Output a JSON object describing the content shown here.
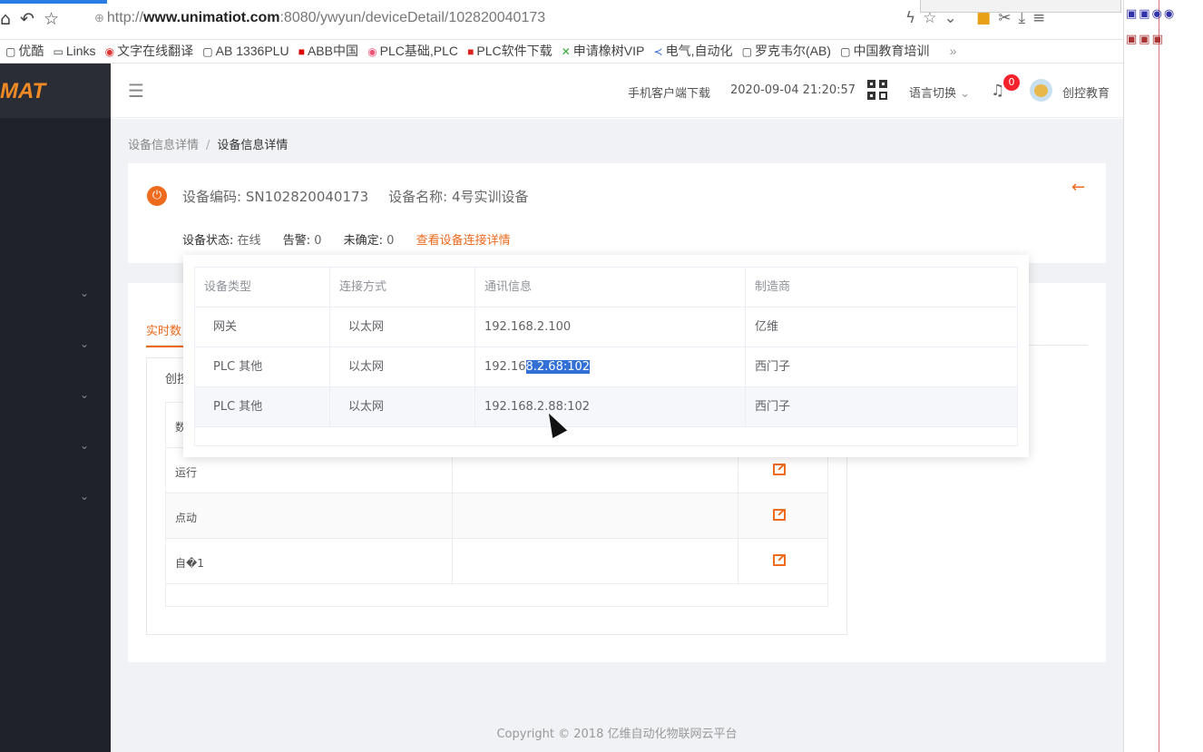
{
  "browser": {
    "url_domain": "www.unimatiot.com",
    "url_prefix": "http://",
    "url_suffix": ":8080/ywyun/deviceDetail/102820040173",
    "bookmarks": [
      "优酷",
      "Links",
      "文字在线翻译",
      "AB 1336PLU",
      "ABB中国",
      "PLC基础,PLC",
      "PLC软件下载",
      "申请橡树VIP",
      "电气,自动化",
      "罗克韦尔(AB)",
      "中国教育培训"
    ],
    "more": "»"
  },
  "sidebar": {
    "logo": "MAT"
  },
  "header": {
    "mobile_download": "手机客户端下载",
    "datetime": "2020-09-04 21:20:57",
    "language": "语言切换",
    "notification_count": "0",
    "user_name": "创控教育"
  },
  "breadcrumb": {
    "parent": "设备信息详情",
    "current": "设备信息详情"
  },
  "device": {
    "code_label": "设备编码:",
    "code_value": "SN102820040173",
    "name_label": "设备名称:",
    "name_value": "4号实训设备",
    "status_label": "设备状态:",
    "status_value": "在线",
    "alarm_label": "告警:",
    "alarm_value": "0",
    "unconfirmed_label": "未确定:",
    "unconfirmed_value": "0",
    "view_link": "查看设备连接详情"
  },
  "main": {
    "tab_label": "实时数",
    "inner_label": "创控",
    "rows": [
      {
        "name": "数"
      },
      {
        "name": "运行"
      },
      {
        "name": "点动"
      },
      {
        "name": "自�1"
      }
    ]
  },
  "popup": {
    "headers": [
      "设备类型",
      "连接方式",
      "通讯信息",
      "制造商"
    ],
    "rows": [
      {
        "type": "网关",
        "conn": "以太网",
        "comm_a": "192.168.2.100",
        "comm_b": "",
        "maker": "亿维"
      },
      {
        "type": "PLC   其他",
        "conn": "以太网",
        "comm_a": "192.16",
        "comm_b": "8.2.68:102",
        "maker": "西门子"
      },
      {
        "type": "PLC   其他",
        "conn": "以太网",
        "comm_a": "192.168.2.88:102",
        "comm_b": "",
        "maker": "西门子"
      }
    ]
  },
  "footer": "Copyright © 2018 亿维自动化物联网云平台",
  "colors": {
    "accent": "#ee6a1d",
    "sidebar": "#20222a",
    "selection": "#3370d6",
    "badge": "#f5222d"
  }
}
